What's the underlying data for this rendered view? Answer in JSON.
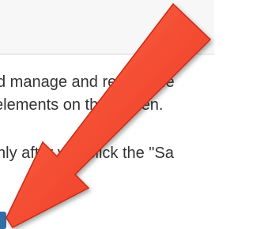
{
  "content": {
    "line1": "d manage and review the",
    "line2": "elements on the screen.",
    "line3": "nly after you click the \"Sa"
  },
  "colors": {
    "arrow_fill": "#f0432a",
    "arrow_edge": "#c92a15",
    "save_button": "#2f6ea8"
  },
  "icons": {
    "annotation": "pointer-arrow-icon"
  }
}
